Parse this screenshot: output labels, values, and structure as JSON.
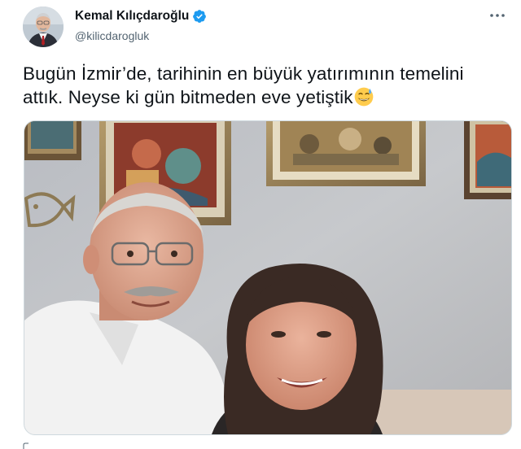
{
  "author": {
    "name": "Kemal Kılıçdaroğlu",
    "handle": "@kilicdarogluk",
    "verified": true,
    "avatar_icon": "profile-photo"
  },
  "tweet": {
    "text": "Bugün İzmir’de, tarihinin en büyük yatırımının temelini attık. Neyse ki gün bitmeden eve yetiştik",
    "emoji": "grinning-face-with-sweat"
  },
  "media": {
    "type": "photo",
    "description_icon": "selfie-photo"
  },
  "icons": {
    "more": "more-options-icon",
    "verified": "verified-badge-icon"
  },
  "colors": {
    "brand_blue": "#1d9bf0",
    "text_primary": "#0f1419",
    "text_secondary": "#536471"
  }
}
